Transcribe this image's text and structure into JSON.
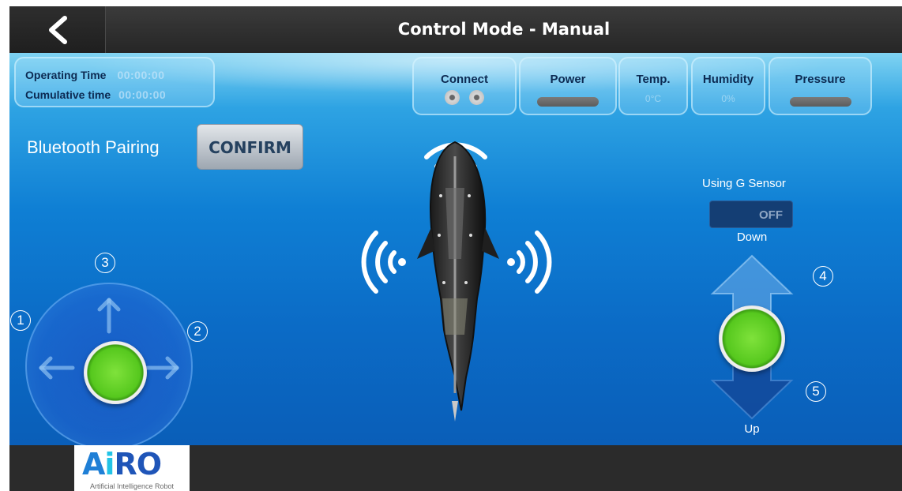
{
  "header": {
    "title": "Control Mode - Manual",
    "back_icon": "chevron-left-icon"
  },
  "time_panel": {
    "operating_label": "Operating Time",
    "operating_value": "00:00:00",
    "cumulative_label": "Cumulative time",
    "cumulative_value": "00:00:00"
  },
  "status": {
    "connect": {
      "label": "Connect"
    },
    "power": {
      "label": "Power"
    },
    "temp": {
      "label": "Temp.",
      "value": "0°C"
    },
    "humidity": {
      "label": "Humidity",
      "value": "0%"
    },
    "pressure": {
      "label": "Pressure"
    }
  },
  "bluetooth": {
    "label": "Bluetooth Pairing",
    "button": "CONFIRM"
  },
  "gsensor": {
    "label": "Using G Sensor",
    "state": "OFF"
  },
  "depth": {
    "down_label": "Down",
    "up_label": "Up"
  },
  "markers": {
    "m1": "1",
    "m2": "2",
    "m3": "3",
    "m4": "4",
    "m5": "5"
  },
  "logo": {
    "brand": "AiRO",
    "tagline": "Artificial Intelligence Robot"
  },
  "colors": {
    "knob_green": "#56c81e",
    "title_bar": "#2f2f2f",
    "water_blue": "#0b6bc6"
  }
}
